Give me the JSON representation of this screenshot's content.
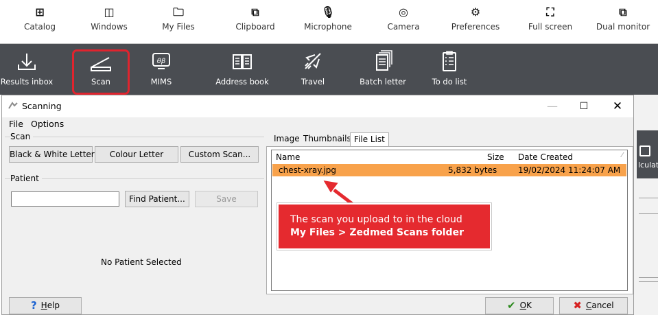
{
  "topbar": {
    "items": [
      {
        "label": "Catalog",
        "icon": "plus-box-icon"
      },
      {
        "label": "Windows",
        "icon": "window-icon"
      },
      {
        "label": "My Files",
        "icon": "folder-icon"
      },
      {
        "label": "Clipboard",
        "icon": "clipboard-copy-icon"
      },
      {
        "label": "Microphone",
        "icon": "microphone-off-icon"
      },
      {
        "label": "Camera",
        "icon": "webcam-icon"
      },
      {
        "label": "Preferences",
        "icon": "gear-icon"
      },
      {
        "label": "Full screen",
        "icon": "fullscreen-icon"
      },
      {
        "label": "Dual monitor",
        "icon": "dual-monitor-icon"
      }
    ]
  },
  "toolbar": {
    "items": [
      {
        "label": "Results inbox",
        "icon": "download-tray-icon"
      },
      {
        "label": "Scan",
        "icon": "scanner-icon"
      },
      {
        "label": "MIMS",
        "icon": "mims-icon"
      },
      {
        "label": "Address book",
        "icon": "book-icon"
      },
      {
        "label": "Travel",
        "icon": "airplane-icon"
      },
      {
        "label": "Batch letter",
        "icon": "documents-stack-icon"
      },
      {
        "label": "To do list",
        "icon": "checklist-icon"
      }
    ],
    "highlighted": "Scan",
    "highlight_color": "#e0242e",
    "background": "#4a4d52",
    "right_partial_label": "lculato"
  },
  "dialog": {
    "title": "Scanning",
    "menu": [
      "File",
      "Options"
    ],
    "scan_group": {
      "label": "Scan",
      "buttons": [
        "Black & White Letter",
        "Colour Letter",
        "Custom Scan..."
      ]
    },
    "patient_group": {
      "label": "Patient",
      "input_value": "",
      "find_button": "Find Patient...",
      "save_button": "Save",
      "status": "No Patient Selected"
    },
    "tabs": [
      {
        "label": "Image",
        "active": false
      },
      {
        "label": "Thumbnails",
        "active": false
      },
      {
        "label": "File List",
        "active": true
      }
    ],
    "file_list": {
      "columns": [
        "Name",
        "Size",
        "Date Created"
      ],
      "rows": [
        {
          "name": "chest-xray.jpg",
          "size": "5,832 bytes",
          "date": "19/02/2024 11:24:07 AM",
          "selected": true
        }
      ],
      "selected_color": "#f8a24b"
    },
    "footer": {
      "help": "Help",
      "help_mnemonic": "H",
      "help_rest": "elp",
      "ok": "OK",
      "ok_mnemonic": "O",
      "ok_rest": "K",
      "cancel": "Cancel",
      "cancel_mnemonic": "C",
      "cancel_rest": "ancel"
    }
  },
  "callout": {
    "line1": "The scan you upload to in the cloud",
    "line2": "My Files > Zedmed Scans folder",
    "color": "#e52a2f"
  }
}
